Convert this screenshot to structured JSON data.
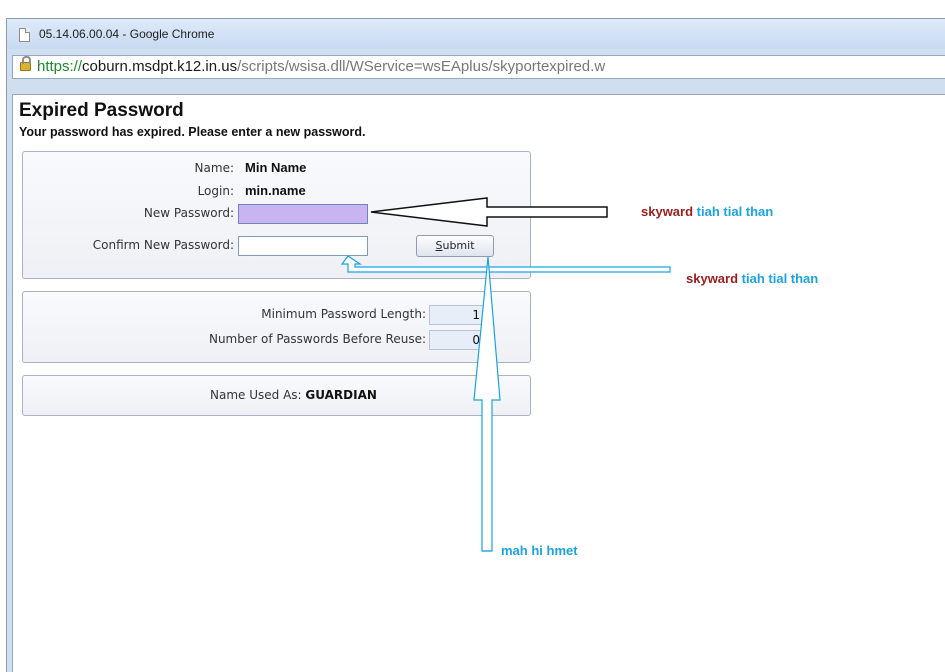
{
  "window": {
    "title": "05.14.06.00.04 - Google Chrome"
  },
  "address": {
    "scheme": "https://",
    "host": "coburn.msdpt.k12.in.us",
    "path": "/scripts/wsisa.dll/WService=wsEAplus/skyportexpired.w"
  },
  "page": {
    "title": "Expired Password",
    "subtitle": "Your password has expired. Please enter a new password."
  },
  "form": {
    "name_label": "Name:",
    "name_value": "Min Name",
    "login_label": "Login:",
    "login_value": "min.name",
    "new_password_label": "New Password:",
    "confirm_password_label": "Confirm New Password:",
    "submit_first_letter": "S",
    "submit_rest": "ubmit"
  },
  "rules": {
    "min_length_label": "Minimum Password Length:",
    "min_length_value": "1",
    "reuse_label": "Number of Passwords Before Reuse:",
    "reuse_value": "0"
  },
  "usage": {
    "label": "Name Used As:",
    "value": "GUARDIAN"
  },
  "annotations": {
    "a1_red": "skyward",
    "a1_blue": "tiah tial than",
    "a2_red": "skyward",
    "a2_blue": "tiah tial than",
    "a3_blue": "mah hi hmet"
  },
  "colors": {
    "active_field": "#c8b4f0",
    "annotation_red": "#9b1c1c",
    "annotation_blue": "#1aa3e0"
  }
}
